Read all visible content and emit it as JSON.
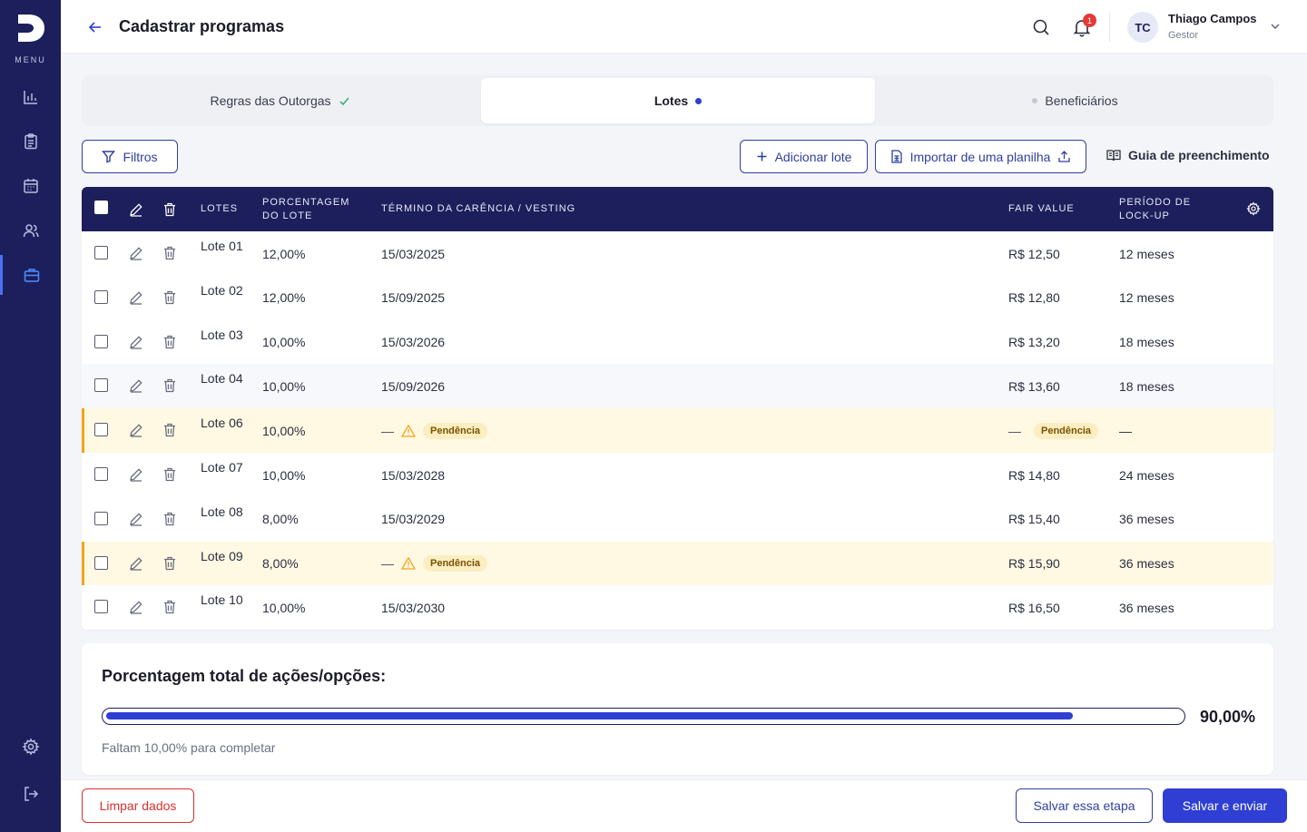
{
  "sidebar": {
    "menu_label": "MENU",
    "items": [
      {
        "icon": "bar-chart-icon"
      },
      {
        "icon": "clipboard-icon"
      },
      {
        "icon": "calendar-icon"
      },
      {
        "icon": "users-icon"
      },
      {
        "icon": "briefcase-icon",
        "active": true
      },
      {
        "icon": "gear-icon"
      },
      {
        "icon": "logout-icon"
      }
    ]
  },
  "header": {
    "title": "Cadastrar programas",
    "notification_count": "1",
    "user": {
      "initials": "TC",
      "name": "Thiago Campos",
      "role": "Gestor"
    }
  },
  "stepper": {
    "steps": [
      {
        "label": "Regras das Outorgas",
        "status": "completed"
      },
      {
        "label": "Lotes",
        "status": "active"
      },
      {
        "label": "Beneficiários",
        "status": "pending"
      }
    ]
  },
  "toolbar": {
    "filters_label": "Filtros",
    "add_label": "Adicionar lote",
    "import_label": "Importar de uma planilha",
    "guide_label": "Guia de preenchimento"
  },
  "table": {
    "columns": {
      "lotes": "LOTES",
      "percentage": "PORCENTAGEM DO LOTE",
      "vesting": "TÉRMINO DA CARÊNCIA / VESTING",
      "fair_value": "FAIR VALUE",
      "lockup": "PERÍODO DE LOCK-UP"
    },
    "pending_label": "Pendência",
    "dash": "—",
    "rows": [
      {
        "name": "Lote 01",
        "percentage": "12,00%",
        "vesting": "15/03/2025",
        "fair_value": "R$ 12,50",
        "lockup": "12 meses"
      },
      {
        "name": "Lote 02",
        "percentage": "12,00%",
        "vesting": "15/09/2025",
        "fair_value": "R$ 12,80",
        "lockup": "12 meses"
      },
      {
        "name": "Lote 03",
        "percentage": "10,00%",
        "vesting": "15/03/2026",
        "fair_value": "R$ 13,20",
        "lockup": "18 meses"
      },
      {
        "name": "Lote 04",
        "percentage": "10,00%",
        "vesting": "15/09/2026",
        "fair_value": "R$ 13,60",
        "lockup": "18 meses"
      },
      {
        "name": "Lote 06",
        "percentage": "10,00%",
        "vesting": "—",
        "fair_value": "—",
        "lockup": "—"
      },
      {
        "name": "Lote 07",
        "percentage": "10,00%",
        "vesting": "15/03/2028",
        "fair_value": "R$ 14,80",
        "lockup": "24 meses"
      },
      {
        "name": "Lote 08",
        "percentage": "8,00%",
        "vesting": "15/03/2029",
        "fair_value": "R$ 15,40",
        "lockup": "36 meses"
      },
      {
        "name": "Lote 09",
        "percentage": "8,00%",
        "vesting": "—",
        "fair_value": "R$ 15,90",
        "lockup": "36 meses"
      },
      {
        "name": "Lote 10",
        "percentage": "10,00%",
        "vesting": "15/03/2030",
        "fair_value": "R$ 16,50",
        "lockup": "36 meses"
      }
    ]
  },
  "progress": {
    "title": "Porcentagem total de ações/opções:",
    "value_label": "90,00%",
    "fraction": 0.9,
    "hint": "Faltam 10,00% para completar"
  },
  "footer": {
    "clear_label": "Limpar dados",
    "save_step_label": "Salvar essa etapa",
    "save_send_label": "Salvar e enviar"
  },
  "colors": {
    "sidebar_bg": "#1c1f5c",
    "accent": "#2f3fd3",
    "pending_bg": "#fff9e3",
    "pending_border": "#f0a51a",
    "danger": "#d93030"
  }
}
